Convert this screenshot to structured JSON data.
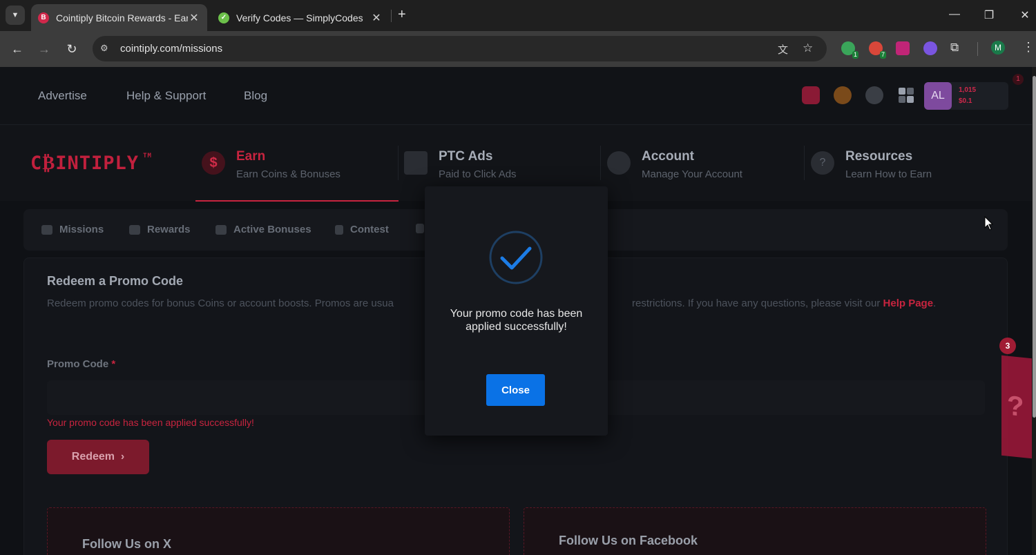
{
  "browser": {
    "tabs": [
      {
        "title": "Cointiply Bitcoin Rewards - Earn",
        "favicon": "cointiply-icon",
        "active": true
      },
      {
        "title": "Verify Codes — SimplyCodes",
        "favicon": "simplycodes-icon",
        "active": false
      }
    ],
    "url": "cointiply.com/missions",
    "profile_initial": "M",
    "extension_badges": {
      "green": "1",
      "red": "7"
    }
  },
  "topnav": {
    "links": [
      "Advertise",
      "Help & Support",
      "Blog"
    ],
    "avatar_initials": "AL",
    "coins": "1,015",
    "balance": "$0.1",
    "notification_count": "1"
  },
  "logo": {
    "text": "C₿INTIPLY",
    "tm": "TM"
  },
  "mainnav": [
    {
      "title": "Earn",
      "subtitle": "Earn Coins & Bonuses",
      "icon": "dollar-icon",
      "active": true
    },
    {
      "title": "PTC Ads",
      "subtitle": "Paid to Click Ads",
      "icon": "cursor-click-icon",
      "active": false
    },
    {
      "title": "Account",
      "subtitle": "Manage Your Account",
      "icon": "users-icon",
      "active": false
    },
    {
      "title": "Resources",
      "subtitle": "Learn How to Earn",
      "icon": "question-icon",
      "active": false
    }
  ],
  "subtabs": [
    "Missions",
    "Rewards",
    "Active Bonuses",
    "Contest"
  ],
  "promo": {
    "title": "Redeem a Promo Code",
    "description_start": "Redeem promo codes for bonus Coins or account boosts. Promos are usua",
    "description_end": "restrictions. If you have any questions, please visit our ",
    "help_link": "Help Page",
    "help_link_suffix": ".",
    "field_label": "Promo Code",
    "required_marker": "*",
    "field_value": "",
    "status_message": "Your promo code has been applied successfully!",
    "redeem_label": "Redeem"
  },
  "follow": [
    {
      "title": "Follow Us on X"
    },
    {
      "title": "Follow Us on Facebook"
    }
  ],
  "side_widget": {
    "badge": "3",
    "glyph": "?"
  },
  "modal": {
    "message": "Your promo code has been applied successfully!",
    "close_label": "Close"
  },
  "colors": {
    "accent": "#c8243f",
    "primary_button": "#0a72e6",
    "background": "#0f1115"
  }
}
